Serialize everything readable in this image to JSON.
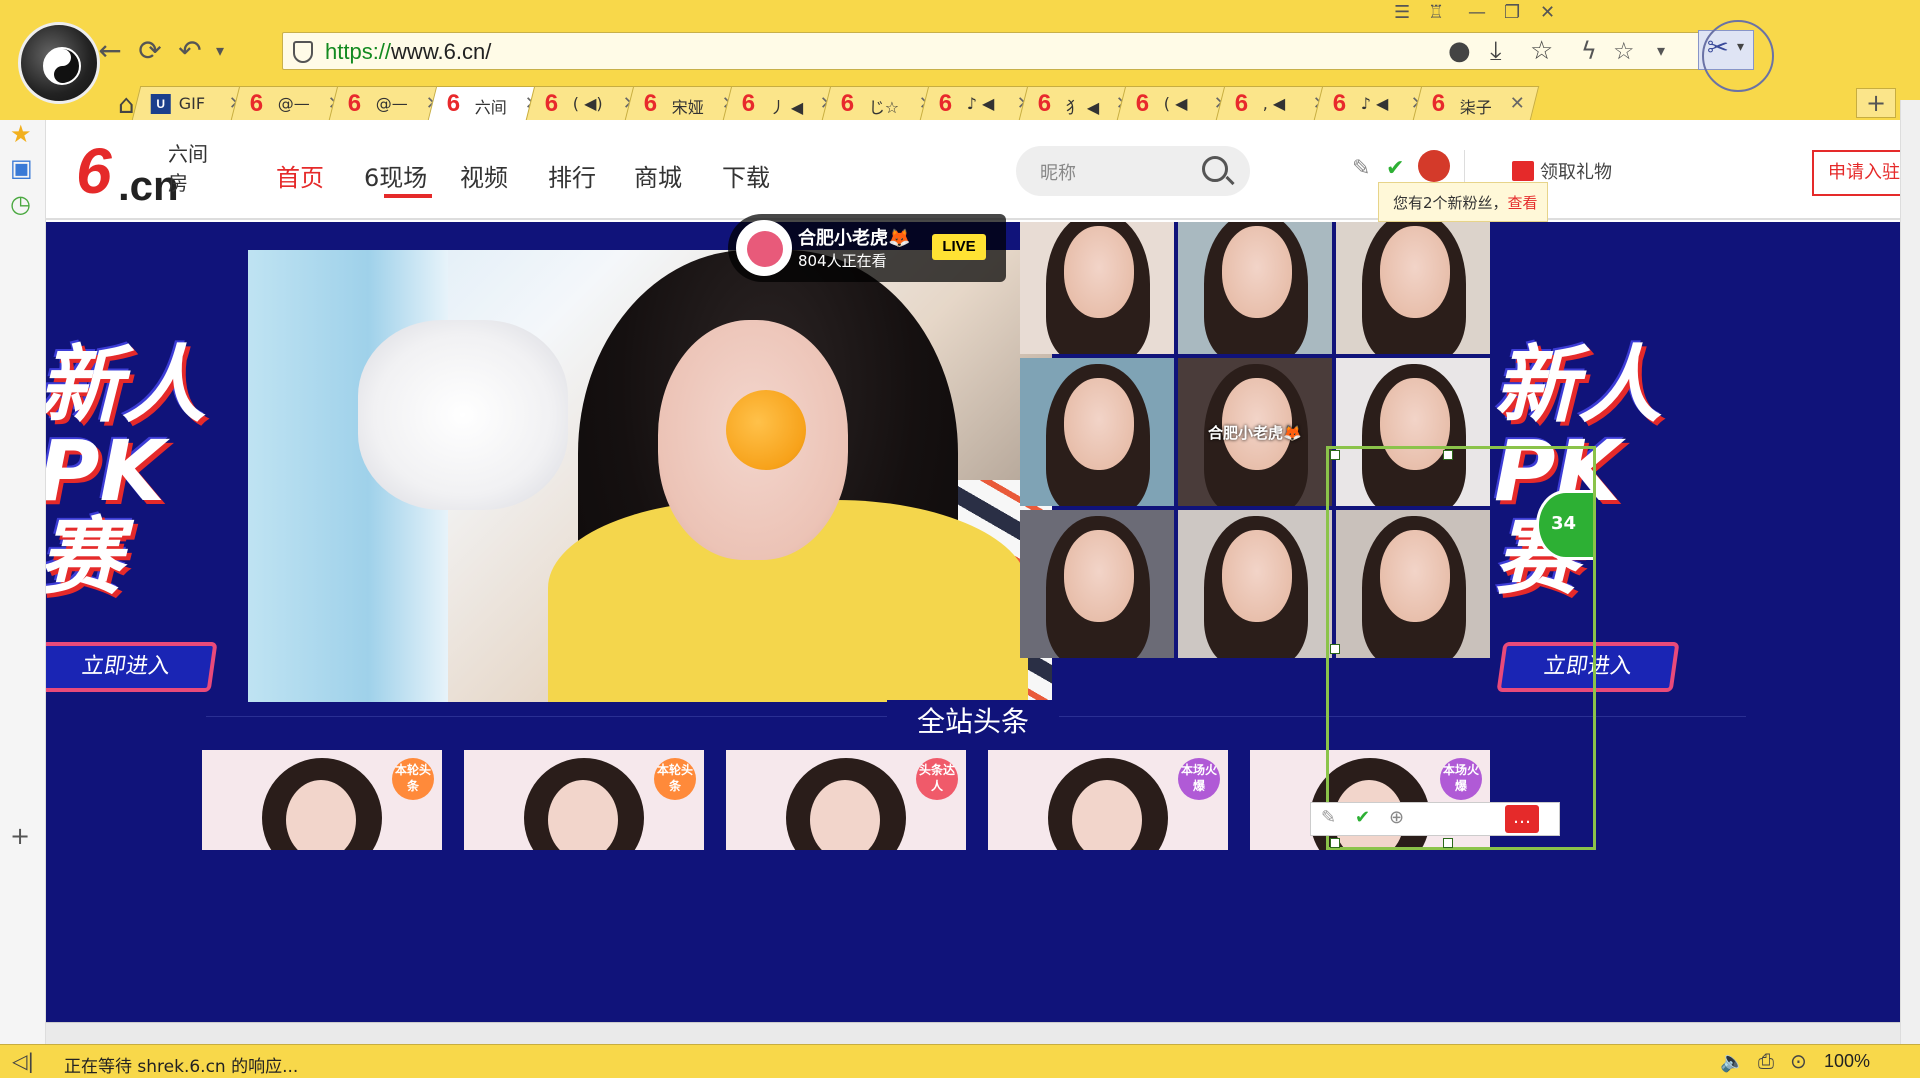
{
  "browser": {
    "url_scheme": "https://",
    "url_rest": "www.6.cn/",
    "tabs": [
      {
        "fav": "GIF",
        "title": "GIF",
        "active": false
      },
      {
        "fav": "6",
        "title": "@—",
        "active": false
      },
      {
        "fav": "6",
        "title": "@—",
        "active": false
      },
      {
        "fav": "6",
        "title": "六间",
        "active": true
      },
      {
        "fav": "6",
        "title": "( ◀)",
        "active": false
      },
      {
        "fav": "6",
        "title": "宋娅",
        "active": false
      },
      {
        "fav": "6",
        "title": "丿 ◀",
        "active": false
      },
      {
        "fav": "6",
        "title": "じ☆",
        "active": false
      },
      {
        "fav": "6",
        "title": "♪ ◀",
        "active": false
      },
      {
        "fav": "6",
        "title": "犭 ◀",
        "active": false
      },
      {
        "fav": "6",
        "title": "( ◀",
        "active": false
      },
      {
        "fav": "6",
        "title": ", ◀",
        "active": false
      },
      {
        "fav": "6",
        "title": "♪ ◀",
        "active": false
      },
      {
        "fav": "6",
        "title": "柒子",
        "active": false
      }
    ],
    "new_tab": "+",
    "status_text": "正在等待 shrek.6.cn 的响应...",
    "zoom": "100%"
  },
  "site": {
    "logo_six": "6",
    "logo_cn": ".cn",
    "logo_name": "六间房",
    "menu": [
      {
        "label": "首页",
        "active": true
      },
      {
        "label": "6现场",
        "active": false
      },
      {
        "label": "视频",
        "active": false
      },
      {
        "label": "排行",
        "active": false
      },
      {
        "label": "商城",
        "active": false
      },
      {
        "label": "下载",
        "active": false
      }
    ],
    "search_placeholder": "昵称",
    "gift_label": "领取礼物",
    "apply_label": "申请入驻",
    "fans_tip": "您有2个新粉丝，",
    "fans_link": "查看"
  },
  "main": {
    "promo_big_1": "新人",
    "promo_big_2": "PK赛",
    "promo_enter": "立即进入",
    "live": {
      "name": "合肥小老虎🦊",
      "viewers": "804人正在看",
      "badge": "LIVE"
    },
    "thumb_name": "合肥小老虎🦊",
    "headline": "全站头条",
    "cards": [
      {
        "tag": "本轮头条",
        "color": "#ff8a3a"
      },
      {
        "tag": "本轮头条",
        "color": "#ff8a3a"
      },
      {
        "tag": "头条达人",
        "color": "#f05a6a"
      },
      {
        "tag": "本场火爆",
        "color": "#b05ad6"
      },
      {
        "tag": "本场火爆",
        "color": "#b05ad6"
      }
    ],
    "green_badge": "34"
  }
}
